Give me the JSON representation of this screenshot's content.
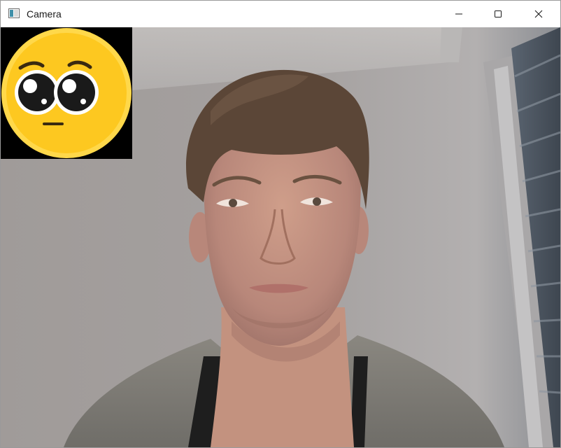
{
  "window": {
    "title": "Camera",
    "app_icon": "opencv-window-icon",
    "controls": {
      "minimize_icon": "minimize-icon",
      "maximize_icon": "maximize-icon",
      "close_icon": "close-icon"
    }
  },
  "viewport": {
    "content": "webcam-frame",
    "overlay_icon": "pleading-face-emoji",
    "colors": {
      "wall": "#a29e9c",
      "emoji_face": "#fdc820",
      "emoji_rim": "#ffd84a",
      "overlay_bg": "#000000"
    }
  }
}
